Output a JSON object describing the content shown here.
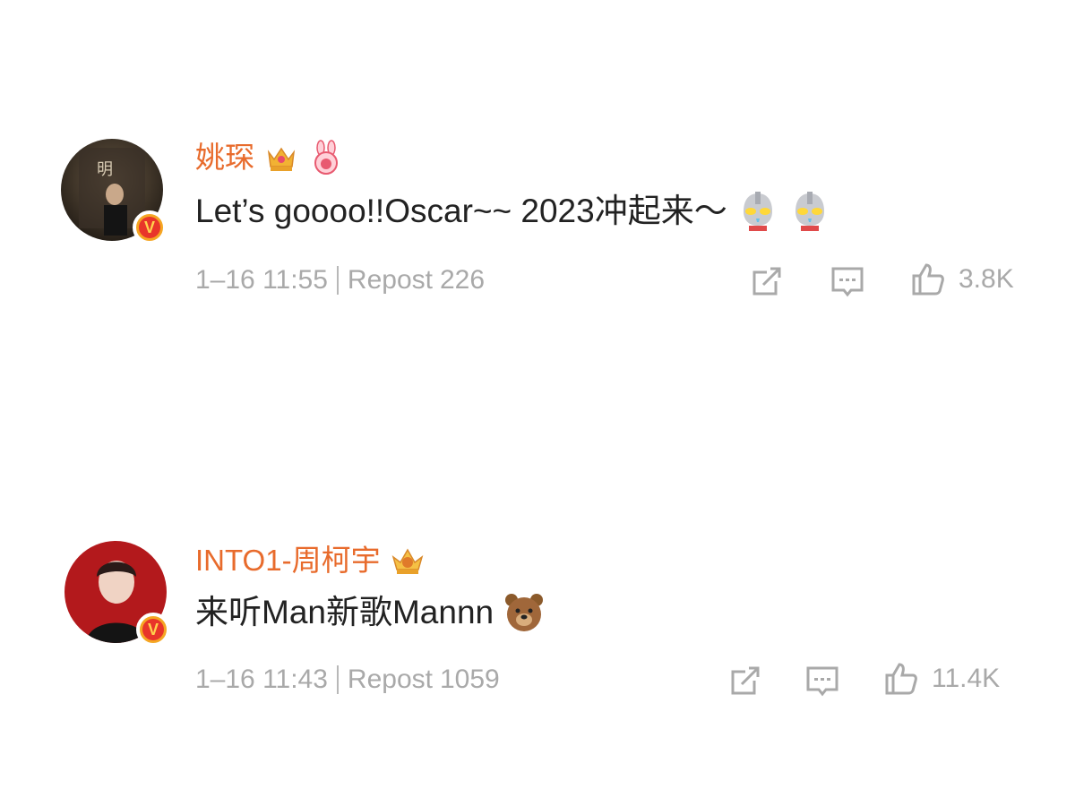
{
  "posts": [
    {
      "author": "姚琛",
      "text": "Let’s goooo!!Oscar~~ 2023冲起来～",
      "emojis": [
        "ultraman-emoji",
        "ultraman-emoji"
      ],
      "badges": [
        "crown-badge-icon",
        "rabbit-badge-icon"
      ],
      "time": "1–16 11:55",
      "repost_label": "Repost",
      "repost_count": "226",
      "like_count": "3.8K",
      "verified_mark": "V"
    },
    {
      "author": "INTO1-周柯宇",
      "text": "来听Man新歌Mannn",
      "emojis": [
        "bear-emoji"
      ],
      "badges": [
        "crown-badge-icon"
      ],
      "time": "1–16 11:43",
      "repost_label": "Repost",
      "repost_count": "1059",
      "like_count": "11.4K",
      "verified_mark": "V"
    }
  ],
  "colors": {
    "author_name": "#e86b2c",
    "meta_text": "#a9a9a9",
    "body_text": "#222222",
    "verified_badge": "#f5a623"
  }
}
